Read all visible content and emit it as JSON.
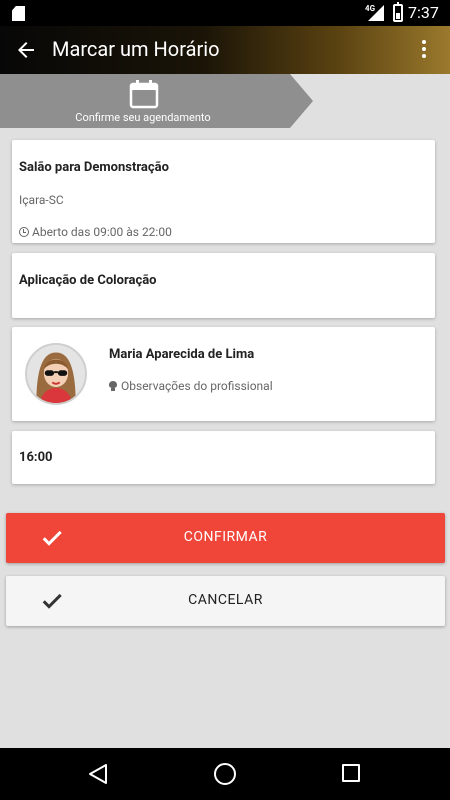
{
  "status_bar": {
    "network": "4G",
    "time": "7:37"
  },
  "app_bar": {
    "title": "Marcar um Horário"
  },
  "step": {
    "icon": "calendar-icon",
    "label": "Confirme seu agendamento"
  },
  "salon": {
    "name": "Salão para Demonstração",
    "city": "Içara-SC",
    "hours": "Aberto das 09:00 às 22:00"
  },
  "service": {
    "name": "Aplicação de Coloração"
  },
  "professional": {
    "name": "Maria Aparecida de Lima",
    "notes_label": "Observações do profissional"
  },
  "appointment": {
    "time": "16:00"
  },
  "actions": {
    "confirm_label": "CONFIRMAR",
    "cancel_label": "CANCELAR"
  },
  "colors": {
    "confirm": "#f0463a",
    "cancel": "#f5f5f5",
    "accent_gold": "#9b7a2d"
  }
}
